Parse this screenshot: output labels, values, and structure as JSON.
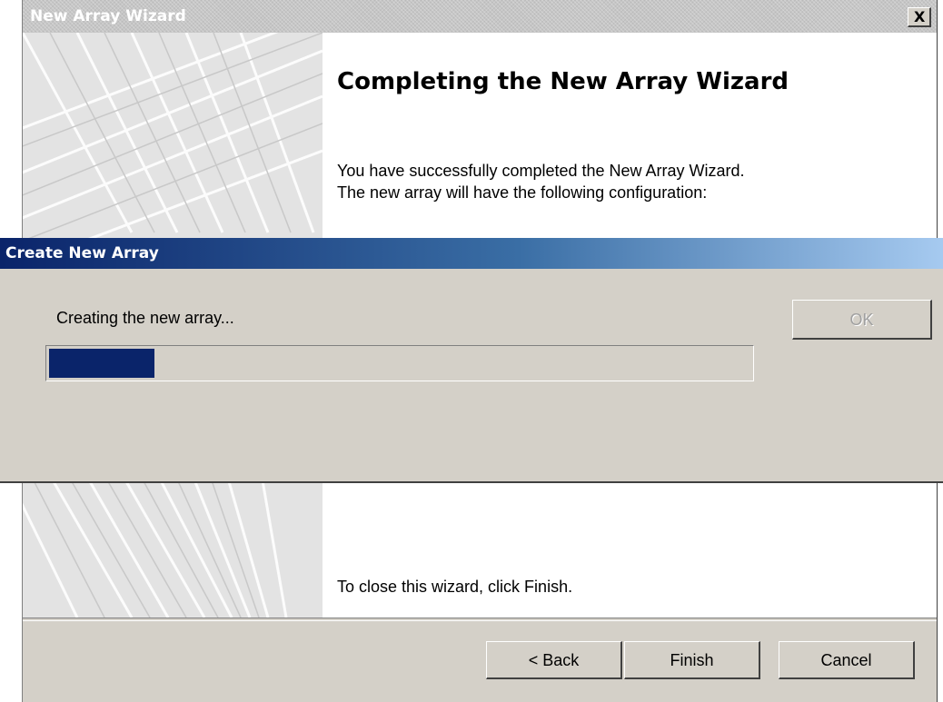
{
  "wizard": {
    "title": "New Array Wizard",
    "close_label": "X",
    "heading": "Completing the New Array Wizard",
    "intro_line1": "You have successfully completed the New Array Wizard.",
    "intro_line2": "The new array will have the following configuration:",
    "closing_text": "To close this wizard, click Finish.",
    "buttons": {
      "back": "< Back",
      "finish": "Finish",
      "cancel": "Cancel"
    }
  },
  "dialog": {
    "title": "Create New Array",
    "status": "Creating the new array...",
    "progress_fraction": 0.15,
    "ok_label": "OK",
    "ok_enabled": false
  },
  "colors": {
    "dialog_title_start": "#0a246a",
    "dialog_title_end": "#a6caf0",
    "progress_fill": "#0a246a",
    "window_face": "#d4d0c8"
  },
  "icons": {
    "close": "close-icon",
    "side_art": "wizard-side-graphic"
  }
}
